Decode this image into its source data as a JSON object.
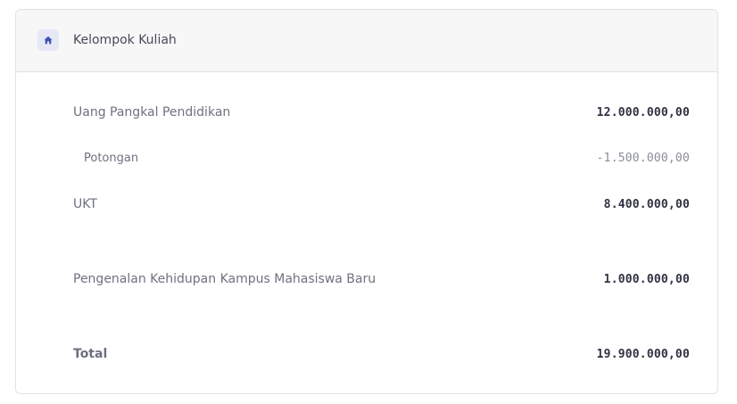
{
  "header": {
    "icon": "home-icon",
    "title": "Kelompok Kuliah"
  },
  "colors": {
    "accent": "#3f51b5",
    "icon_badge_bg": "#e6e8f6",
    "header_bg": "#f7f7f8"
  },
  "rows": [
    {
      "label": "Uang Pangkal Pendidikan",
      "amount": "12.000.000,00"
    },
    {
      "label": "Potongan",
      "amount": "-1.500.000,00"
    },
    {
      "label": "UKT",
      "amount": "8.400.000,00"
    },
    {
      "label": "Pengenalan Kehidupan Kampus Mahasiswa Baru",
      "amount": "1.000.000,00"
    }
  ],
  "total": {
    "label": "Total",
    "amount": "19.900.000,00"
  }
}
